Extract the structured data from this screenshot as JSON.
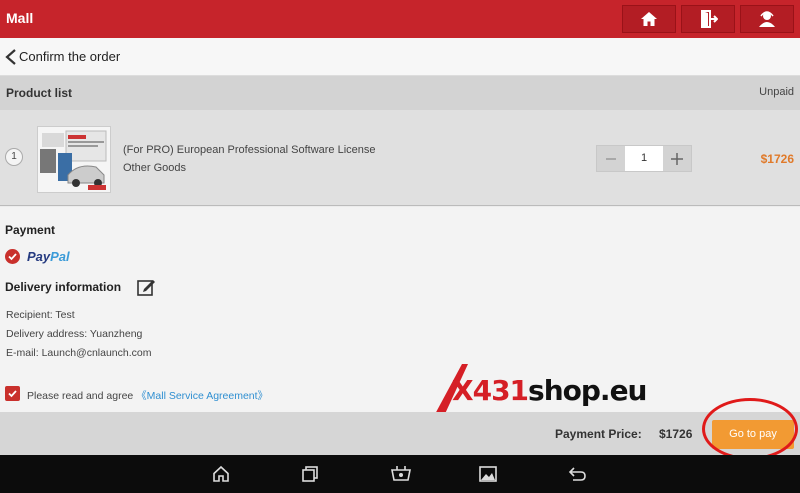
{
  "app": {
    "title": "Mall"
  },
  "header": {
    "back_label": "Confirm the order"
  },
  "product_list": {
    "title": "Product list",
    "status": "Unpaid",
    "items": [
      {
        "index": "1",
        "name": "(For PRO) European Professional Software License",
        "type": "Other Goods",
        "quantity": "1",
        "price": "$1726"
      }
    ]
  },
  "payment": {
    "title": "Payment",
    "method": "PayPal",
    "method_part1": "Pay",
    "method_part2": "Pal"
  },
  "delivery": {
    "title": "Delivery information",
    "recipient": "Recipient: Test",
    "address": "Delivery address: Yuanzheng",
    "email": "E-mail: Launch@cnlaunch.com"
  },
  "agreement": {
    "prefix": "Please read and agree ",
    "link": "《Mall Service Agreement》",
    "checked": true
  },
  "watermark": {
    "brand_red": "X431",
    "brand_black": "shop.eu"
  },
  "footer": {
    "price_label": "Payment Price:",
    "price_value": "$1726",
    "pay_button": "Go to pay"
  },
  "colors": {
    "brand_red": "#c6242b",
    "accent_orange": "#f29a33",
    "price_orange": "#e07a2a",
    "link_blue": "#2f8fd1"
  },
  "icons": [
    "home-icon",
    "exit-icon",
    "user-icon",
    "back-icon",
    "edit-icon",
    "nav-home-icon",
    "nav-recent-icon",
    "nav-vci-icon",
    "nav-gallery-icon",
    "nav-back-icon"
  ]
}
